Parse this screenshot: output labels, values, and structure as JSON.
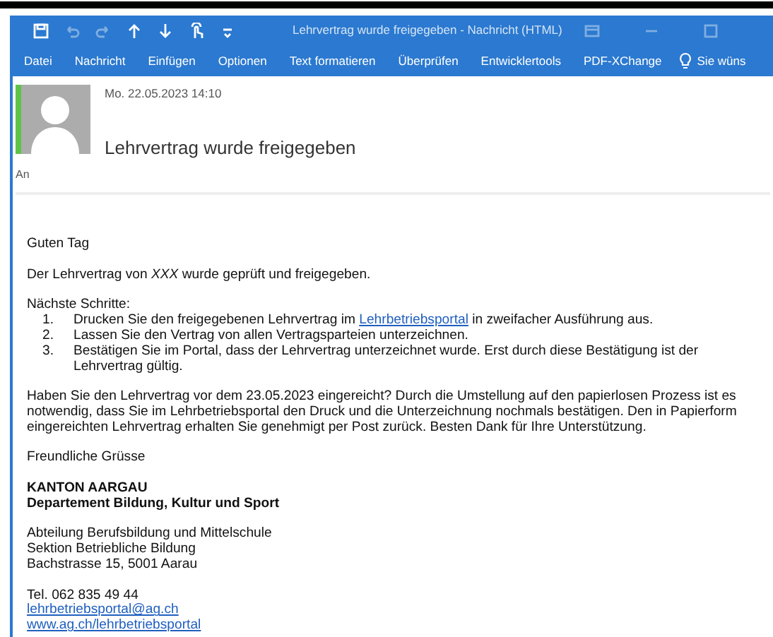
{
  "window": {
    "title": "Lehrvertrag wurde freigegeben - Nachricht (HTML)"
  },
  "ribbon_tabs": [
    {
      "label": "Datei",
      "selected": false
    },
    {
      "label": "Nachricht",
      "selected": false
    },
    {
      "label": "Einfügen",
      "selected": false
    },
    {
      "label": "Optionen",
      "selected": false
    },
    {
      "label": "Text formatieren",
      "selected": false
    },
    {
      "label": "Überprüfen",
      "selected": false
    },
    {
      "label": "Entwicklertools",
      "selected": false
    },
    {
      "label": "PDF-XChange",
      "selected": false
    }
  ],
  "tell_me": {
    "label": "Sie wüns"
  },
  "message": {
    "date": "Mo. 22.05.2023 14:10",
    "subject": "Lehrvertrag wurde freigegeben",
    "to_label": "An"
  },
  "body": [
    {
      "kind": "text",
      "lines": [
        "Guten Tag"
      ]
    },
    {
      "kind": "text",
      "lines": [
        "Der Lehrvertrag von *XXX*  wurde geprüft und freigegeben."
      ]
    },
    {
      "kind": "list",
      "heading": "Nächste Schritte:",
      "items": [
        {
          "number": "1.",
          "before": "Drucken Sie den freigegebenen Lehrvertrag im ",
          "link": "Lehrbetriebsportal",
          "after": " in zweifacher Ausführung aus."
        },
        {
          "number": "2.",
          "before": "Lassen Sie den Vertrag von allen Vertragsparteien unterzeichnen."
        },
        {
          "number": "3.",
          "before": "Bestätigen Sie im Portal, dass der Lehrvertrag unterzeichnet wurde. Erst durch diese Bestätigung ist der Lehrvertrag gültig."
        }
      ]
    },
    {
      "kind": "text",
      "lines": [
        "Haben Sie den Lehrvertrag vor dem 23.05.2023 eingereicht? Durch die Umstellung auf den papierlosen Prozess ist es notwendig, dass Sie im Lehrbetriebsportal den Druck und die Unterzeichnung nochmals bestätigen. Den in Papierform eingereichten Lehrvertrag erhalten Sie genehmigt per Post zurück. Besten Dank für Ihre Unterstützung."
      ]
    },
    {
      "kind": "text",
      "lines": [
        "Freundliche Grüsse"
      ]
    },
    {
      "kind": "bold",
      "lines": [
        "KANTON AARGAU",
        "Departement Bildung, Kultur und Sport"
      ]
    },
    {
      "kind": "text",
      "lines": [
        "Abteilung Berufsbildung und Mittelschule",
        "Sektion Betriebliche Bildung",
        "Bachstrasse 15, 5001 Aarau"
      ]
    },
    {
      "kind": "contact",
      "lines": [
        "Tel. 062 835 49 44"
      ],
      "links": [
        "lehrbetriebsportal@ag.ch",
        "www.ag.ch/lehrbetriebsportal"
      ]
    }
  ]
}
